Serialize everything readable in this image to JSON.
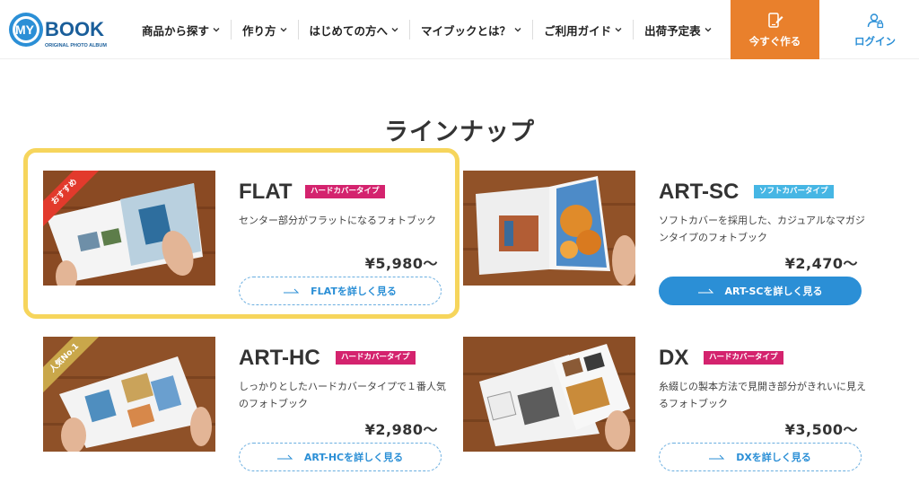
{
  "header": {
    "logo": {
      "word": "MY BOOK",
      "subtitle": "ORIGINAL PHOTO ALBUM"
    },
    "nav": [
      {
        "label": "商品から探す"
      },
      {
        "label": "作り方"
      },
      {
        "label": "はじめての方へ"
      },
      {
        "label": "マイブックとは？"
      },
      {
        "label": "ご利用ガイド"
      },
      {
        "label": "出荷予定表"
      }
    ],
    "cta_label": "今すぐ作る",
    "login_label": "ログイン",
    "cta_color": "#e9802c",
    "accent_color": "#2b8fd6"
  },
  "section": {
    "title": "ラインナップ"
  },
  "products": [
    {
      "name": "FLAT",
      "tag": "ハードカバータイプ",
      "desc": "センター部分がフラットになるフォトブック",
      "price": "¥5,980〜",
      "button": "FLATを詳しく見る",
      "ribbon": "おすすめ"
    },
    {
      "name": "ART-SC",
      "tag": "ソフトカバータイプ",
      "desc": "ソフトカバーを採用した、カジュアルなマガジンタイプのフォトブック",
      "price": "¥2,470〜",
      "button": "ART-SCを詳しく見る"
    },
    {
      "name": "ART-HC",
      "tag": "ハードカバータイプ",
      "desc": "しっかりとしたハードカバータイプで１番人気のフォトブック",
      "price": "¥2,980〜",
      "button": "ART-HCを詳しく見る",
      "ribbon": "人気No.1"
    },
    {
      "name": "DX",
      "tag": "ハードカバータイプ",
      "desc": "糸綴じの製本方法で見開き部分がきれいに見えるフォトブック",
      "price": "¥3,500〜",
      "button": "DXを詳しく見る"
    }
  ],
  "icons": {
    "cta": "tablet-pen-icon",
    "login": "user-icon",
    "chevron": "chevron-down-icon",
    "arrow": "arrow-right-icon"
  }
}
